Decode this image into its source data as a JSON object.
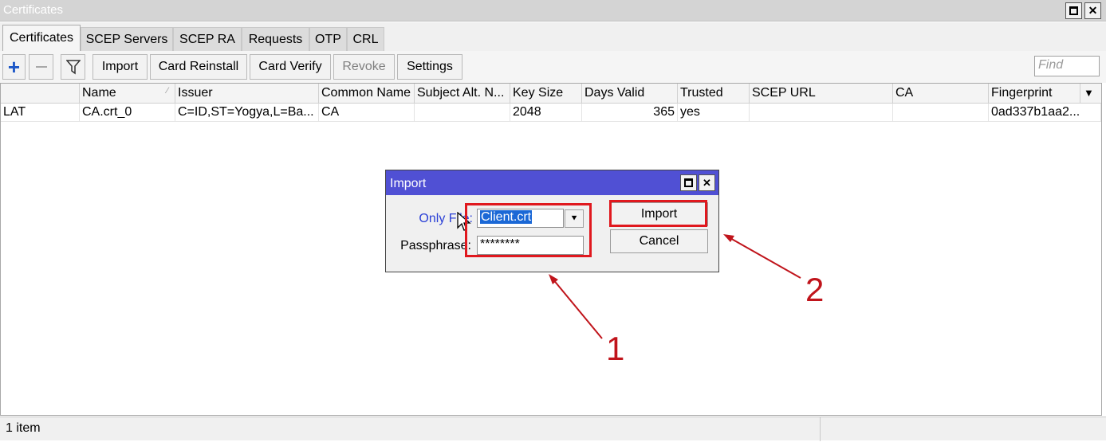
{
  "window": {
    "title": "Certificates"
  },
  "tabs": [
    {
      "label": "Certificates",
      "active": true
    },
    {
      "label": "SCEP Servers",
      "active": false
    },
    {
      "label": "SCEP RA",
      "active": false
    },
    {
      "label": "Requests",
      "active": false
    },
    {
      "label": "OTP",
      "active": false
    },
    {
      "label": "CRL",
      "active": false
    }
  ],
  "toolbar": {
    "add_icon": "plus-icon",
    "remove_icon": "minus-icon",
    "filter_icon": "filter-icon",
    "import_label": "Import",
    "card_reinstall_label": "Card Reinstall",
    "card_verify_label": "Card Verify",
    "revoke_label": "Revoke",
    "settings_label": "Settings",
    "find_placeholder": "Find"
  },
  "table": {
    "columns": [
      "",
      "Name",
      "Issuer",
      "Common Name",
      "Subject Alt. N...",
      "Key Size",
      "Days Valid",
      "Trusted",
      "SCEP URL",
      "CA",
      "Fingerprint"
    ],
    "rows": [
      {
        "flags": "LAT",
        "name": "CA.crt_0",
        "issuer": "C=ID,ST=Yogya,L=Ba...",
        "common_name": "CA",
        "subject_alt": "",
        "key_size": "2048",
        "days_valid": "365",
        "trusted": "yes",
        "scep_url": "",
        "ca": "",
        "fingerprint": "0ad337b1aa2..."
      }
    ]
  },
  "status": {
    "text": "1 item"
  },
  "dialog": {
    "title": "Import",
    "only_file_label": "Only File:",
    "only_file_value": "Client.crt",
    "passphrase_label": "Passphrase:",
    "passphrase_value": "********",
    "import_button": "Import",
    "cancel_button": "Cancel"
  },
  "annotations": {
    "label_1": "1",
    "label_2": "2",
    "color": "#e0181e"
  },
  "colors": {
    "dialog_title_bg": "#5050d4",
    "link": "#2a3fd6",
    "selection": "#1b68d6"
  }
}
